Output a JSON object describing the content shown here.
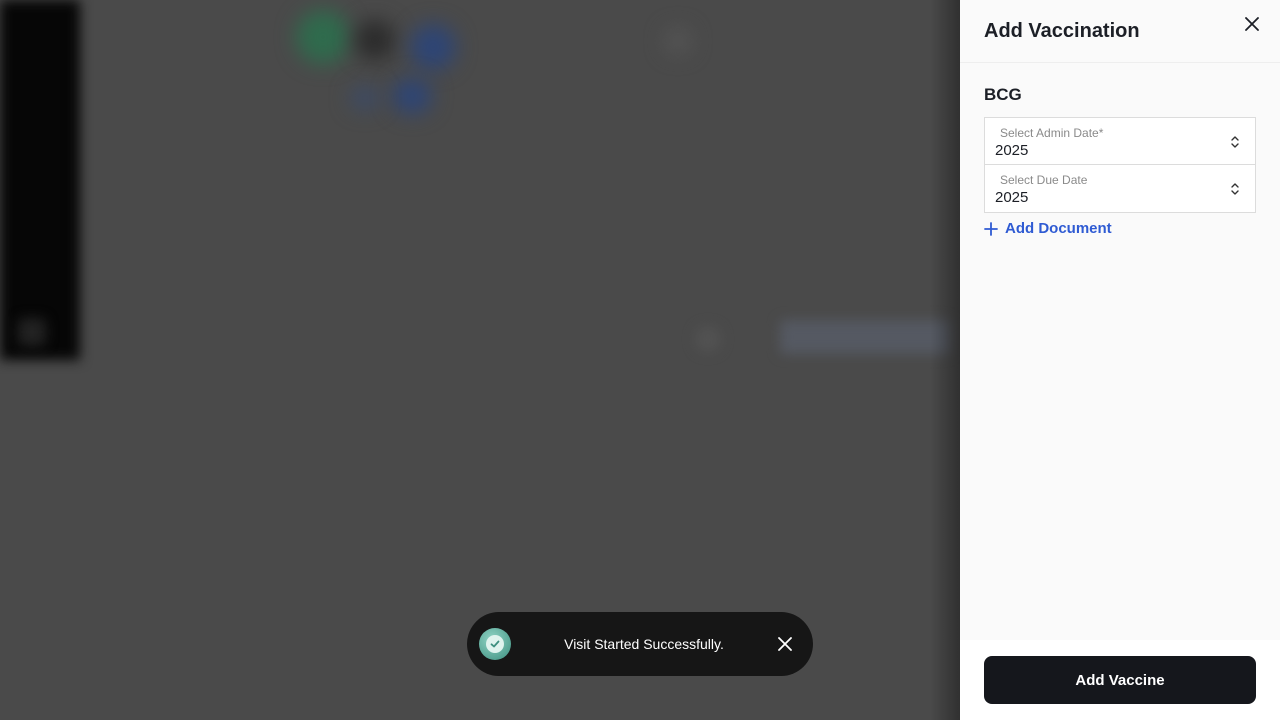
{
  "drawer": {
    "title": "Add Vaccination",
    "close_icon": "close-icon",
    "vaccine_name": "BCG",
    "admin_date": {
      "label": "Select Admin Date*",
      "value": "2025"
    },
    "due_date": {
      "label": "Select Due Date",
      "value": "2025"
    },
    "add_document_label": "Add Document",
    "submit_label": "Add Vaccine"
  },
  "toast": {
    "message": "Visit Started Successfully.",
    "icon": "check-circle-icon",
    "close_icon": "close-icon"
  },
  "colors": {
    "accent_link": "#2f5bd3",
    "primary_button": "#15171c",
    "toast_bg": "#161616",
    "toast_icon": "#3d8f7f"
  }
}
